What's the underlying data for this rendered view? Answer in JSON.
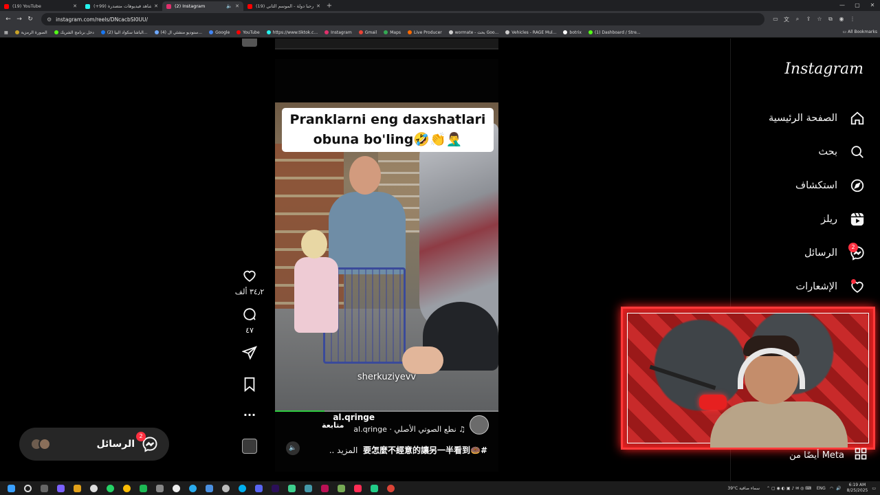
{
  "browser": {
    "tabs": [
      {
        "title": "(19) YouTube",
        "color": "#ff0000",
        "active": false
      },
      {
        "title": "شاهد فيديوهات متصدرة (99+)",
        "color": "#25f4ee",
        "active": false
      },
      {
        "title": "(2) Instagram",
        "color": "#e1306c",
        "active": true
      },
      {
        "title": "(19) مرحبا دولة - الموسم الثاني",
        "color": "#ff0000",
        "active": false
      }
    ],
    "url": "instagram.com/reels/DNcacbSI0UU/",
    "bookmarks": [
      {
        "label": "الصورة الرمزية",
        "color": "#c9a227"
      },
      {
        "label": "دخل برنامج الشريك",
        "color": "#53fc18"
      },
      {
        "label": "(2) الباشا سكواد البيا...",
        "color": "#1877f2"
      },
      {
        "label": "(4) ستوديو منشئي ال...",
        "color": "#6ea8fe"
      },
      {
        "label": "Google",
        "color": "#4285f4"
      },
      {
        "label": "YouTube",
        "color": "#ff0000"
      },
      {
        "label": "https://www.tiktok.c...",
        "color": "#25f4ee"
      },
      {
        "label": "Instagram",
        "color": "#e1306c"
      },
      {
        "label": "Gmail",
        "color": "#ea4335"
      },
      {
        "label": "Maps",
        "color": "#34a853"
      },
      {
        "label": "Live Producer",
        "color": "#ff6a00"
      },
      {
        "label": "wormate - بحث Goo...",
        "color": "#cccccc"
      },
      {
        "label": "Vehicles - RAGE Mul...",
        "color": "#cccccc"
      },
      {
        "label": "botrix",
        "color": "#ffffff"
      },
      {
        "label": "(1) Dashboard / Stre...",
        "color": "#53fc18"
      }
    ],
    "all_bookmarks": "All Bookmarks"
  },
  "instagram": {
    "logo": "Instagram",
    "nav": [
      {
        "label": "الصفحة الرئيسية",
        "icon": "home-icon"
      },
      {
        "label": "بحث",
        "icon": "search-icon"
      },
      {
        "label": "استكشاف",
        "icon": "explore-icon"
      },
      {
        "label": "ريلز",
        "icon": "reels-icon"
      },
      {
        "label": "الرسائل",
        "icon": "messenger-icon",
        "badge": "2"
      },
      {
        "label": "الإشعارات",
        "icon": "heart-icon"
      }
    ],
    "meta_link": "أيضًا من Meta",
    "messages_pill": {
      "label": "الرسائل",
      "badge": "2"
    }
  },
  "reel": {
    "caption_line1": "Pranklarni eng daxshatlari",
    "caption_line2": "obuna bo'ling🤣👏🤦‍♂️",
    "watermark": "sherkuziyevv",
    "username": "al.qringe",
    "follow": "متابعة",
    "audio": "♫ نطع الصوتي الأصلي · al.qringe",
    "description": "#🍩要怎麼不經意的讓另一半看到",
    "more": "المزيد ..",
    "likes": "٣٤٫٢ ألف",
    "comments": "٤٧",
    "progress": 0.22
  },
  "taskbar": {
    "weather": "39°C  سماء صافية",
    "lang": "ENG",
    "time": "6:19 AM",
    "date": "8/25/2025"
  }
}
